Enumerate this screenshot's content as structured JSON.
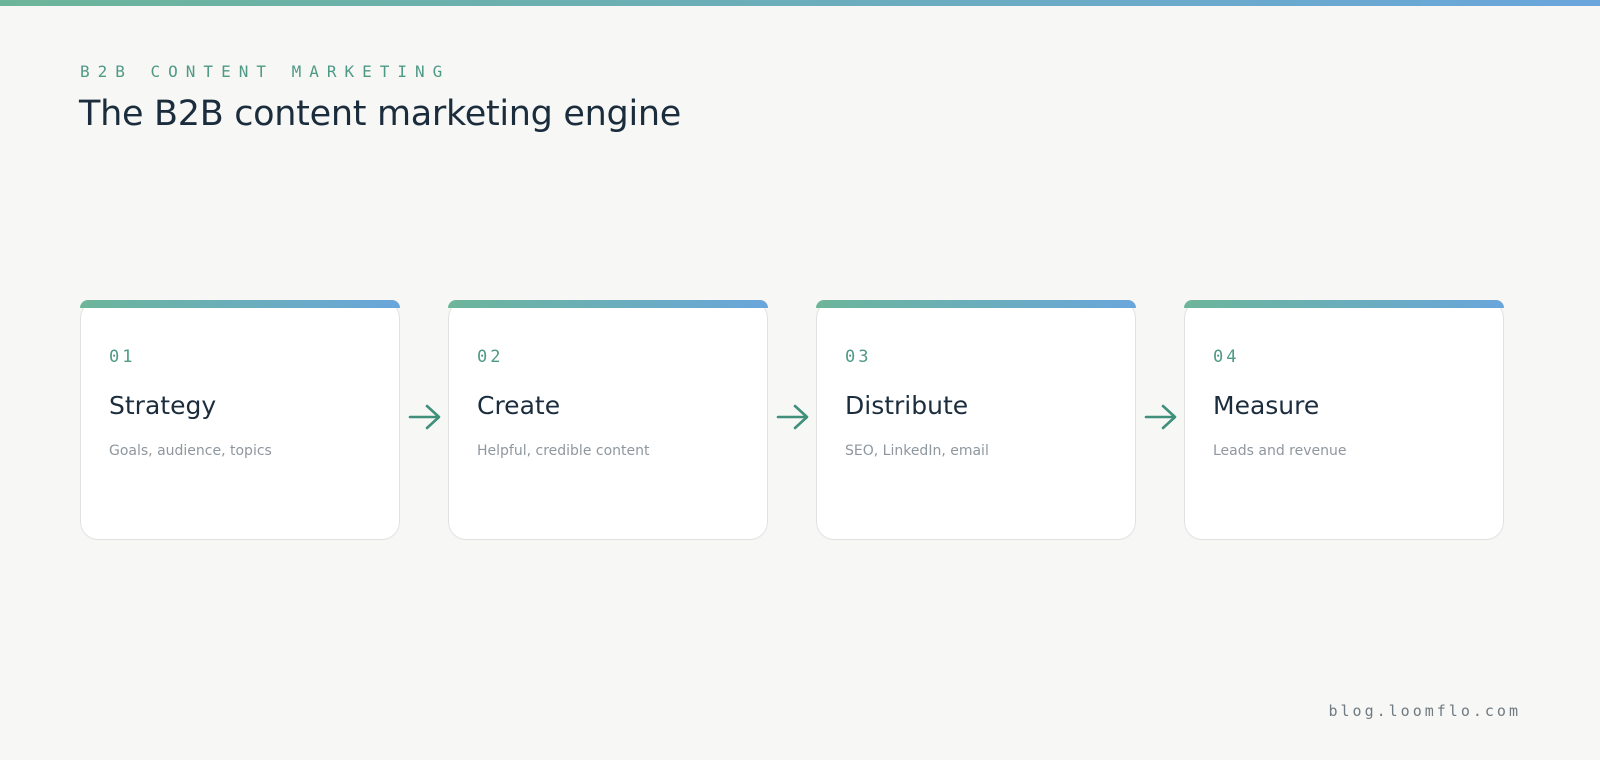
{
  "header": {
    "eyebrow": "B2B CONTENT MARKETING",
    "title": "The B2B content marketing engine"
  },
  "steps": [
    {
      "number": "01",
      "title": "Strategy",
      "description": "Goals, audience, topics"
    },
    {
      "number": "02",
      "title": "Create",
      "description": "Helpful, credible content"
    },
    {
      "number": "03",
      "title": "Distribute",
      "description": "SEO, LinkedIn, email"
    },
    {
      "number": "04",
      "title": "Measure",
      "description": "Leads and revenue"
    }
  ],
  "footer": {
    "url": "blog.loomflo.com"
  },
  "colors": {
    "accent_green": "#4f9a86",
    "gradient_start": "#6db59a",
    "gradient_end": "#6aa6dc",
    "title_text": "#1b2d3d",
    "muted_text": "#8e979e",
    "arrow": "#3f8f7b"
  },
  "icons": {
    "connector": "arrow-right-icon"
  }
}
